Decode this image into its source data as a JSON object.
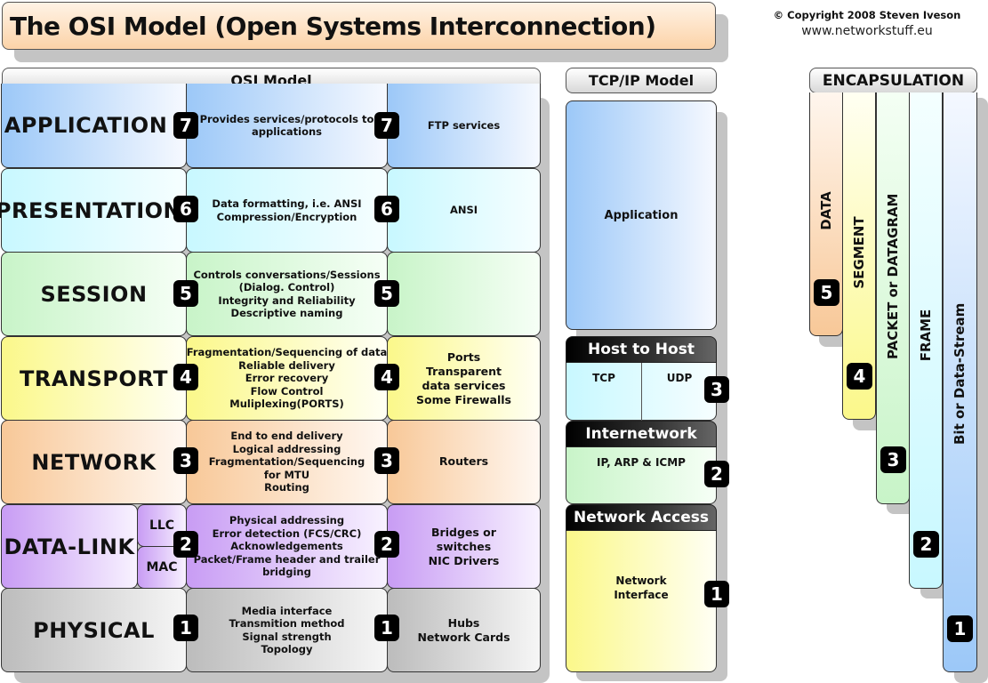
{
  "title": "The OSI Model (Open Systems Interconnection)",
  "copyright": "© Copyright 2008 Steven Iveson",
  "website": "www.networkstuff.eu",
  "osi": {
    "header": "OSI Model",
    "layers": [
      {
        "number": "7",
        "name": "APPLICATION",
        "description": [
          "Provides services/protocols to",
          "applications"
        ],
        "examples": [
          "FTP services"
        ],
        "color": "#9cc8f8"
      },
      {
        "number": "6",
        "name": "PRESENTATION",
        "description": [
          "Data formatting, i.e. ANSI",
          "Compression/Encryption"
        ],
        "examples": [
          "ANSI"
        ],
        "color": "#c8f8ff"
      },
      {
        "number": "5",
        "name": "SESSION",
        "description": [
          "Controls conversations/Sessions",
          "(Dialog. Control)",
          "Integrity and Reliability",
          "Descriptive naming"
        ],
        "examples": [],
        "color": "#c8f4c8"
      },
      {
        "number": "4",
        "name": "TRANSPORT",
        "description": [
          "Fragmentation/Sequencing of data",
          "Reliable delivery",
          "Error recovery",
          "Flow Control",
          "Muliplexing(PORTS)"
        ],
        "examples": [
          "Ports",
          "Transparent",
          "data services",
          "Some Firewalls"
        ],
        "color": "#fbf88a"
      },
      {
        "number": "3",
        "name": "NETWORK",
        "description": [
          "End to end delivery",
          "Logical addressing",
          "Fragmentation/Sequencing",
          "for MTU",
          "Routing"
        ],
        "examples": [
          "Routers"
        ],
        "color": "#f8c898"
      },
      {
        "number": "2",
        "name": "DATA-LINK",
        "sublayers": [
          "LLC",
          "MAC"
        ],
        "description": [
          "Physical addressing",
          "Error detection (FCS/CRC)",
          "Acknowledgements",
          "Packet/Frame header and trailer",
          "bridging"
        ],
        "examples": [
          "Bridges or",
          "switches",
          "NIC Drivers"
        ],
        "color": "#c89cf4"
      },
      {
        "number": "1",
        "name": "PHYSICAL",
        "description": [
          "Media interface",
          "Transmition method",
          "Signal strength",
          "Topology"
        ],
        "examples": [
          "Hubs",
          "Network Cards"
        ],
        "color": "#bcbcbc"
      }
    ]
  },
  "tcpip": {
    "header": "TCP/IP Model",
    "application": {
      "label": "Application"
    },
    "host_to_host": {
      "title": "Host to Host",
      "protocols": [
        "TCP",
        "UDP"
      ],
      "number": "3"
    },
    "internetwork": {
      "title": "Internetwork",
      "protocols": "IP, ARP & ICMP",
      "number": "2"
    },
    "network_access": {
      "title": "Network Access",
      "label": [
        "Network",
        "Interface"
      ],
      "number": "1"
    }
  },
  "encapsulation": {
    "header": "ENCAPSULATION",
    "units": [
      {
        "label": "DATA",
        "number": "5",
        "color": "#f8c898"
      },
      {
        "label": "SEGMENT",
        "number": "4",
        "color": "#fbf88a"
      },
      {
        "label": "PACKET or DATAGRAM",
        "number": "3",
        "color": "#c8f4c8"
      },
      {
        "label": "FRAME",
        "number": "2",
        "color": "#c8f8ff"
      },
      {
        "label": "Bit or Data-Stream",
        "number": "1",
        "color": "#9cc8f8"
      }
    ]
  }
}
